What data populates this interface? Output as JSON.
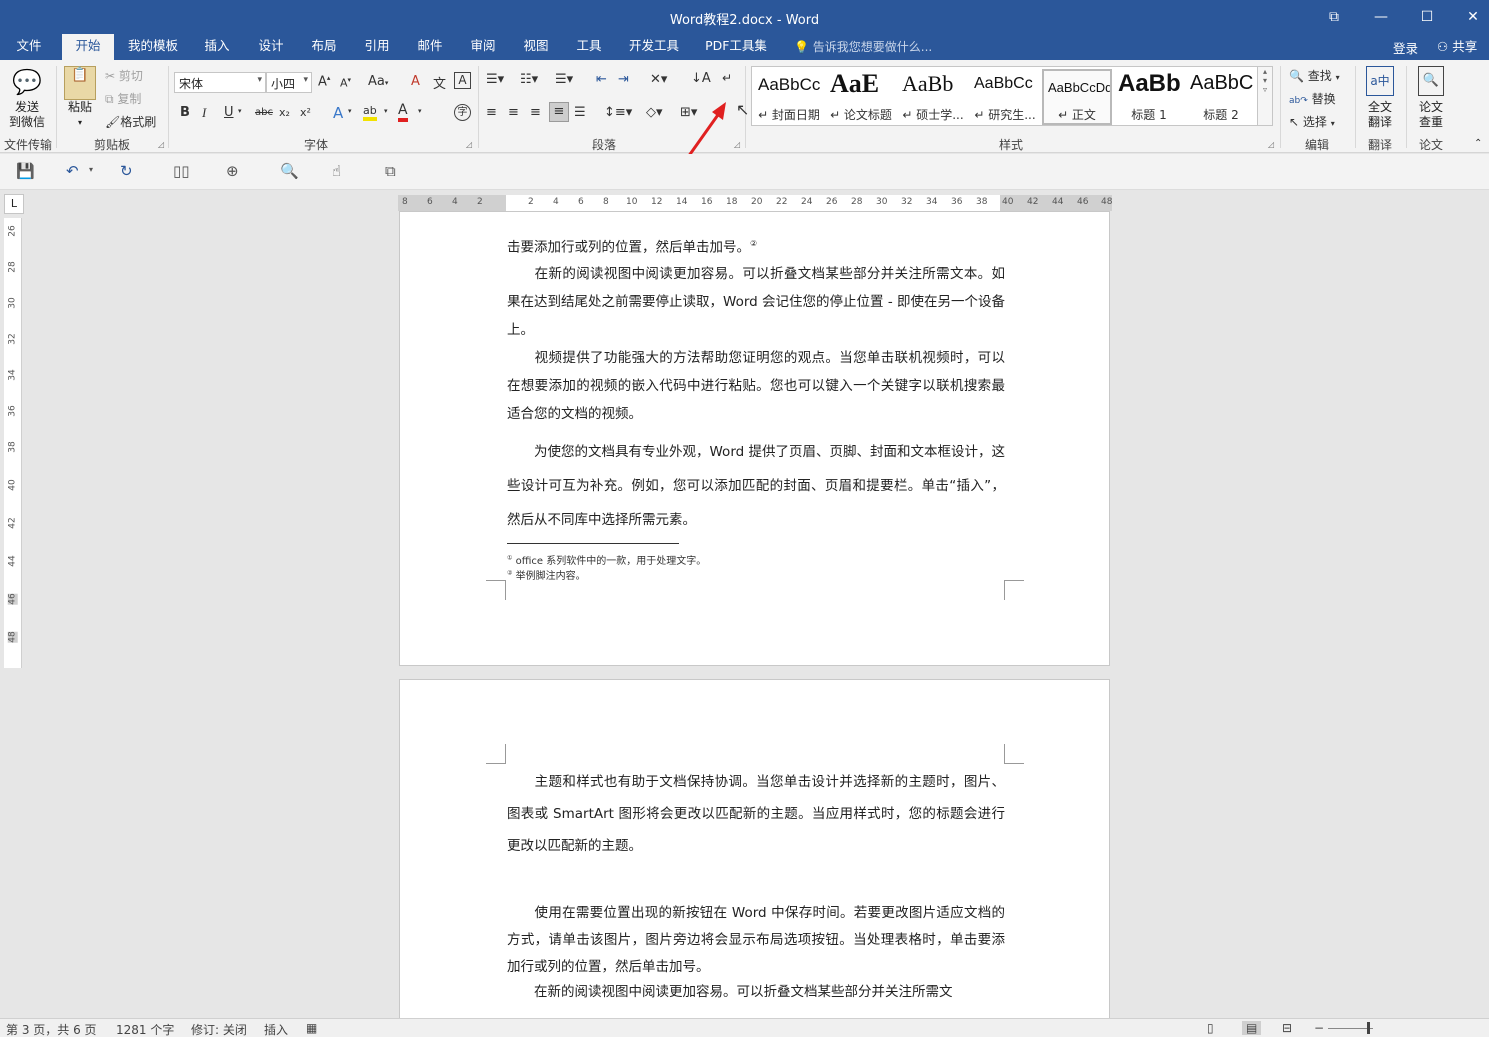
{
  "window": {
    "title": "Word教程2.docx - Word",
    "restore_icon": "⧉",
    "minimize_icon": "—",
    "maximize_icon": "☐",
    "close_icon": "✕"
  },
  "menu_tabs": [
    "文件",
    "开始",
    "我的模板",
    "插入",
    "设计",
    "布局",
    "引用",
    "邮件",
    "审阅",
    "视图",
    "工具",
    "开发工具",
    "PDF工具集"
  ],
  "active_tab": "开始",
  "tell_me": "告诉我您想要做什么...",
  "account": {
    "login": "登录",
    "share": "共享"
  },
  "ribbon": {
    "wechat": {
      "line1": "发送",
      "line2": "到微信",
      "group": "文件传输"
    },
    "clipboard": {
      "paste": "粘贴",
      "cut": "剪切",
      "copy": "复制",
      "format_painter": "格式刷",
      "group": "剪贴板"
    },
    "font": {
      "name": "宋体",
      "size": "小四",
      "grow": "A",
      "shrink": "A",
      "change_case": "Aa",
      "clear_format": "A",
      "pinyin": "文",
      "char_border": "A",
      "bold": "B",
      "italic": "I",
      "underline": "U",
      "strike": "abc",
      "subscript": "x₂",
      "superscript": "x²",
      "text_effect": "A",
      "highlight": "ab",
      "font_color": "A",
      "enclose": "字",
      "group": "字体"
    },
    "paragraph": {
      "group": "段落"
    },
    "styles": {
      "group": "样式",
      "items": [
        {
          "sample": "AaBbCc",
          "name": "↵ 封面日期"
        },
        {
          "sample": "AaE",
          "name": "↵ 论文标题"
        },
        {
          "sample": "AaBb",
          "name": "↵ 硕士学..."
        },
        {
          "sample": "AaBbCc",
          "name": "↵ 研究生..."
        },
        {
          "sample": "AaBbCcDd",
          "name": "↵ 正文"
        },
        {
          "sample": "AaBb",
          "name": "标题 1"
        },
        {
          "sample": "AaBbC",
          "name": "标题 2"
        }
      ]
    },
    "editing": {
      "find": "查找",
      "replace": "替换",
      "select": "选择",
      "group": "编辑"
    },
    "translate": {
      "line1": "全文",
      "line2": "翻译",
      "group": "翻译"
    },
    "thesis": {
      "line1": "论文",
      "line2": "查重",
      "group": "论文"
    }
  },
  "ruler": {
    "h_left": [
      "8",
      "6",
      "4",
      "2"
    ],
    "h_right": [
      "2",
      "4",
      "6",
      "8",
      "10",
      "12",
      "14",
      "16",
      "18",
      "20",
      "22",
      "24",
      "26",
      "28",
      "30",
      "32",
      "34",
      "36",
      "38",
      "40",
      "42",
      "44",
      "46",
      "48"
    ],
    "v": [
      "26",
      "28",
      "30",
      "32",
      "34",
      "36",
      "38",
      "40",
      "42",
      "44",
      "46",
      "48"
    ],
    "corner": "L"
  },
  "page1": {
    "p0": "击要添加行或列的位置，然后单击加号。",
    "p0_mark": "②",
    "p1": "　　在新的阅读视图中阅读更加容易。可以折叠文档某些部分并关注所需文本。如果在达到结尾处之前需要停止读取，Word 会记住您的停止位置 - 即使在另一个设备上。",
    "p2": "　　视频提供了功能强大的方法帮助您证明您的观点。当您单击联机视频时，可以在想要添加的视频的嵌入代码中进行粘贴。您也可以键入一个关键字以联机搜索最适合您的文档的视频。",
    "p3": "　　为使您的文档具有专业外观，Word 提供了页眉、页脚、封面和文本框设计，这些设计可互为补充。例如，您可以添加匹配的封面、页眉和提要栏。单击“插入”，然后从不同库中选择所需元素。",
    "footnote1_mark": "①",
    "footnote1": "office 系列软件中的一款，用于处理文字。",
    "footnote2_mark": "②",
    "footnote2": "举例脚注内容。"
  },
  "page2": {
    "p1": "　　主题和样式也有助于文档保持协调。当您单击设计并选择新的主题时，图片、图表或 SmartArt 图形将会更改以匹配新的主题。当应用样式时，您的标题会进行更改以匹配新的主题。",
    "p2": "　　使用在需要位置出现的新按钮在 Word 中保存时间。若要更改图片适应文档的方式，请单击该图片，图片旁边将会显示布局选项按钮。当处理表格时，单击要添加行或列的位置，然后单击加号。",
    "p3": "　　在新的阅读视图中阅读更加容易。可以折叠文档某些部分并关注所需文"
  },
  "status": {
    "page": "第 3 页，共 6 页",
    "words": "1281 个字",
    "track": "修订: 关闭",
    "insert": "插入"
  },
  "colors": {
    "brand": "#2b579a",
    "arrow": "#e02020"
  }
}
